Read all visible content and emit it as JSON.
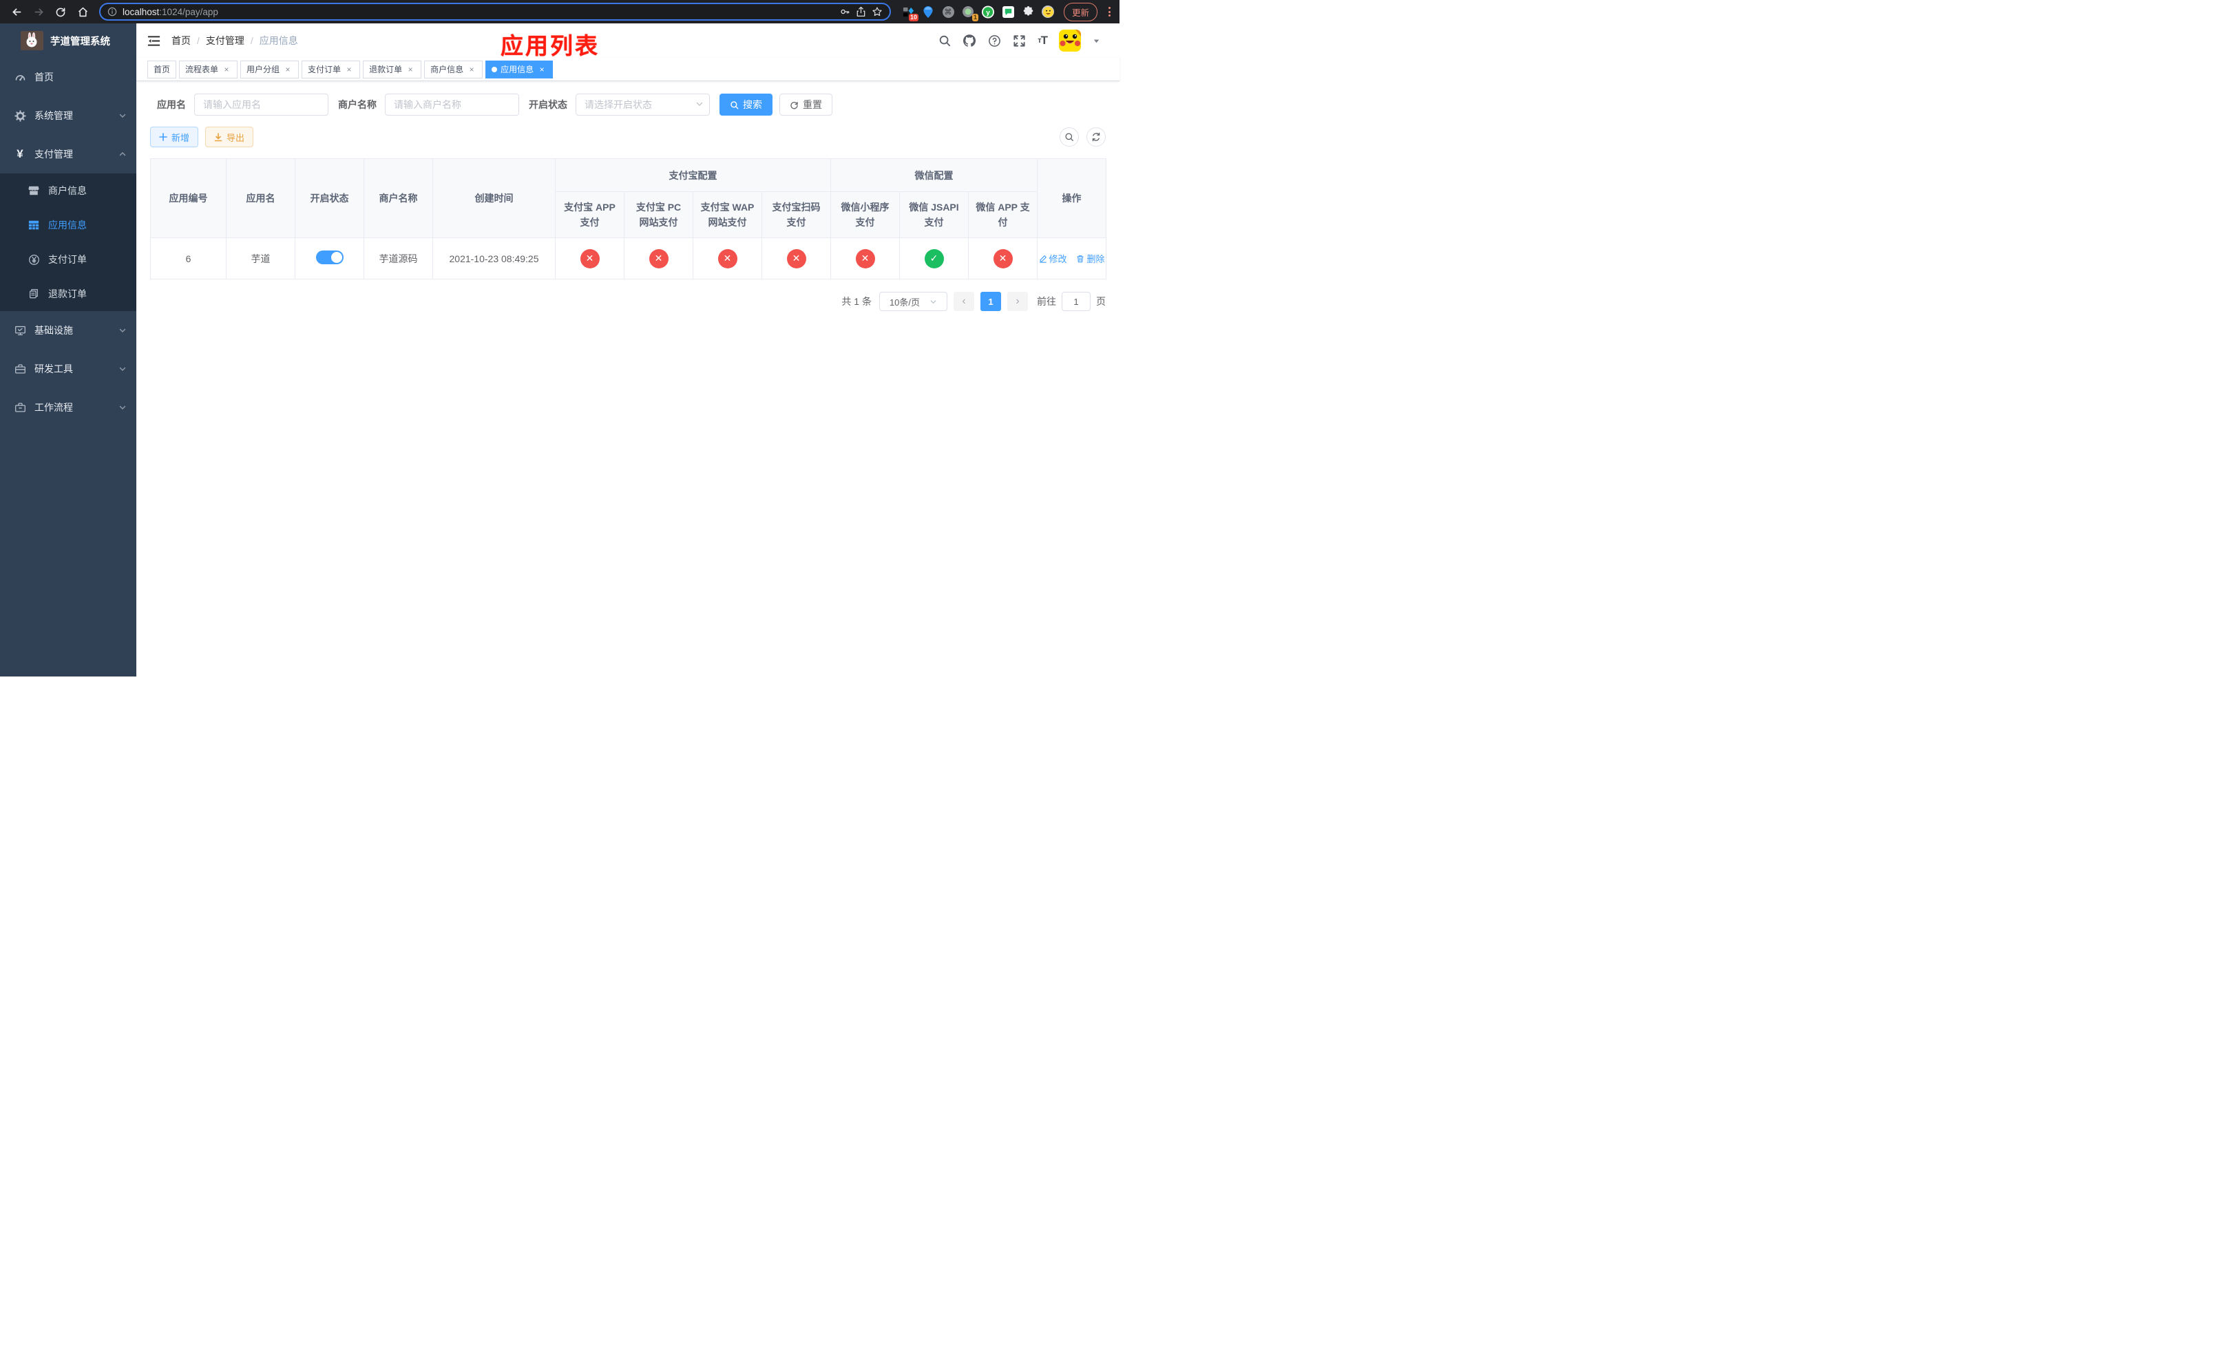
{
  "colors": {
    "accent": "#409eff",
    "danger": "#f3514b",
    "success": "#1cbe62",
    "warning": "#e6a23c",
    "sidebar_bg": "#304156",
    "submenu_bg": "#1f2d3d",
    "annotation_red": "#fe1d10"
  },
  "browser": {
    "url_host": "localhost",
    "url_rest": ":1024/pay/app",
    "update_label": "更新",
    "badge_sketch": "10",
    "badge_proxy": "1"
  },
  "annotation": {
    "text": "应用列表"
  },
  "sidebar": {
    "title": "芋道管理系统",
    "items": [
      {
        "label": "首页"
      },
      {
        "label": "系统管理"
      },
      {
        "label": "支付管理"
      }
    ],
    "sub_items": [
      {
        "label": "商户信息"
      },
      {
        "label": "应用信息"
      },
      {
        "label": "支付订单"
      },
      {
        "label": "退款订单"
      }
    ],
    "bottom_items": [
      {
        "label": "基础设施"
      },
      {
        "label": "研发工具"
      },
      {
        "label": "工作流程"
      }
    ]
  },
  "navbar": {
    "breadcrumb": [
      "首页",
      "支付管理",
      "应用信息"
    ]
  },
  "tags": [
    {
      "label": "首页"
    },
    {
      "label": "流程表单"
    },
    {
      "label": "用户分组"
    },
    {
      "label": "支付订单"
    },
    {
      "label": "退款订单"
    },
    {
      "label": "商户信息"
    },
    {
      "label": "应用信息"
    }
  ],
  "filters": {
    "app_name_label": "应用名",
    "app_name_placeholder": "请输入应用名",
    "merchant_label": "商户名称",
    "merchant_placeholder": "请输入商户名称",
    "status_label": "开启状态",
    "status_placeholder": "请选择开启状态",
    "search_label": "搜索",
    "reset_label": "重置"
  },
  "toolbar": {
    "add_label": "新增",
    "export_label": "导出"
  },
  "table": {
    "columns": [
      "应用编号",
      "应用名",
      "开启状态",
      "商户名称",
      "创建时间"
    ],
    "groups": [
      {
        "label": "支付宝配置",
        "children": [
          "支付宝 APP 支付",
          "支付宝 PC 网站支付",
          "支付宝 WAP 网站支付",
          "支付宝扫码支付"
        ]
      },
      {
        "label": "微信配置",
        "children": [
          "微信小程序支付",
          "微信 JSAPI 支付",
          "微信 APP 支付"
        ]
      }
    ],
    "action_label": "操作",
    "row": {
      "id": "6",
      "name": "芋道",
      "enabled": true,
      "merchant": "芋道源码",
      "created": "2021-10-23 08:49:25",
      "statuses": [
        "no",
        "no",
        "no",
        "no",
        "no",
        "yes",
        "no"
      ],
      "edit_label": "修改",
      "delete_label": "删除"
    }
  },
  "pagination": {
    "total_label": "共 1 条",
    "page_size_label": "10条/页",
    "page": "1",
    "goto_label": "前往",
    "goto_value": "1",
    "page_unit_label": "页"
  },
  "icons": {
    "status_yes": "✓",
    "status_no": "✕",
    "tag_close": "×",
    "prev_arrow": "‹",
    "next_arrow": "›",
    "cmd_glyph": "⌘"
  }
}
